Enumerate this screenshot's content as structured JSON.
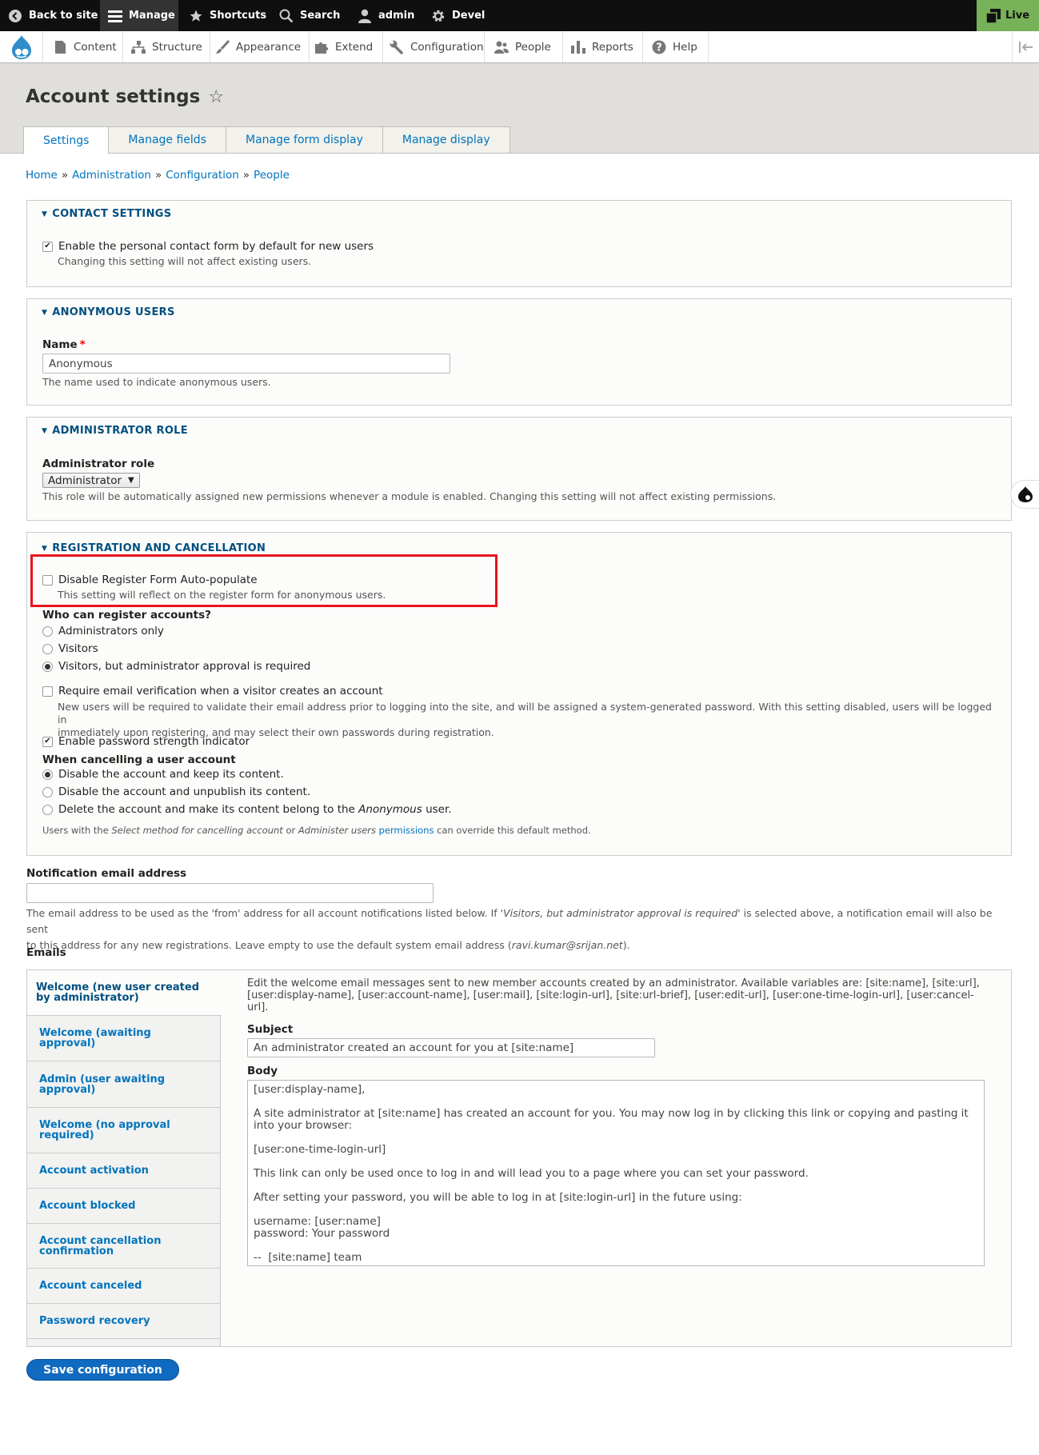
{
  "toolbar": {
    "back_to_site": "Back to site",
    "manage": "Manage",
    "shortcuts": "Shortcuts",
    "search": "Search",
    "user": "admin",
    "devel": "Devel",
    "live": "Live"
  },
  "tray": {
    "items": [
      "Content",
      "Structure",
      "Appearance",
      "Extend",
      "Configuration",
      "People",
      "Reports",
      "Help"
    ]
  },
  "header": {
    "title": "Account settings",
    "tabs": [
      "Settings",
      "Manage fields",
      "Manage form display",
      "Manage display"
    ]
  },
  "breadcrumb": [
    "Home",
    "Administration",
    "Configuration",
    "People"
  ],
  "contact": {
    "legend": "Contact settings",
    "checkbox_label": "Enable the personal contact form by default for new users",
    "checked": true,
    "description": "Changing this setting will not affect existing users."
  },
  "anonymous": {
    "legend": "Anonymous users",
    "name_label": "Name",
    "name_value": "Anonymous",
    "description": "The name used to indicate anonymous users."
  },
  "admin_role": {
    "legend": "Administrator role",
    "label": "Administrator role",
    "selected": "Administrator",
    "description": "This role will be automatically assigned new permissions whenever a module is enabled. Changing this setting will not affect existing permissions."
  },
  "registration": {
    "legend": "Registration and cancellation",
    "disable_autopopulate_label": "Disable Register Form Auto-populate",
    "disable_autopopulate_desc": "This setting will reflect on the register form for anonymous users.",
    "who_label": "Who can register accounts?",
    "who_options": [
      "Administrators only",
      "Visitors",
      "Visitors, but administrator approval is required"
    ],
    "who_selected": 2,
    "email_verify_label": "Require email verification when a visitor creates an account",
    "email_verify_desc_1": "New users will be required to validate their email address prior to logging into the site, and will be assigned a system-generated password. With this setting disabled, users will be logged in",
    "email_verify_desc_2": "immediately upon registering, and may select their own passwords during registration.",
    "pw_strength_label": "Enable password strength indicator",
    "cancel_label": "When cancelling a user account",
    "cancel_options": [
      "Disable the account and keep its content.",
      "Disable the account and unpublish its content."
    ],
    "cancel_opt3_pre": "Delete the account and make its content belong to the",
    "cancel_opt3_em": "Anonymous",
    "cancel_opt3_post": "user.",
    "cancel_desc_pre": "Users with the",
    "cancel_desc_em1": "Select method for cancelling account",
    "cancel_desc_or": "or",
    "cancel_desc_em2": "Administer users",
    "cancel_desc_link": "permissions",
    "cancel_desc_post": "can override this default method."
  },
  "notification": {
    "label": "Notification email address",
    "value": "",
    "desc_1_pre": "The email address to be used as the 'from' address for all account notifications listed below. If '",
    "desc_1_em": "Visitors, but administrator approval is required",
    "desc_1_post": "' is selected above, a notification email will also be sent",
    "desc_2_pre": "to this address for any new registrations. Leave empty to use the default system email address (",
    "desc_2_em": "ravi.kumar@srijan.net",
    "desc_2_post": ")."
  },
  "emails": {
    "label": "Emails",
    "tabs": [
      "Welcome (new user created by administrator)",
      "Welcome (awaiting approval)",
      "Admin (user awaiting approval)",
      "Welcome (no approval required)",
      "Account activation",
      "Account blocked",
      "Account cancellation confirmation",
      "Account canceled",
      "Password recovery"
    ],
    "intro": "Edit the welcome email messages sent to new member accounts created by an administrator. Available variables are: [site:name], [site:url], [user:display-name], [user:account-name], [user:mail], [site:login-url], [site:url-brief], [user:edit-url], [user:one-time-login-url], [user:cancel-url].",
    "subject_label": "Subject",
    "subject_value": "An administrator created an account for you at [site:name]",
    "body_label": "Body",
    "body_value": "[user:display-name],\n\nA site administrator at [site:name] has created an account for you. You may now log in by clicking this link or copying and pasting it into your browser:\n\n[user:one-time-login-url]\n\nThis link can only be used once to log in and will lead you to a page where you can set your password.\n\nAfter setting your password, you will be able to log in at [site:login-url] in the future using:\n\nusername: [user:name]\npassword: Your password\n\n--  [site:name] team"
  },
  "save_button": "Save configuration",
  "colors": {
    "link": "#0074bd",
    "legend": "#004f80",
    "live": "#77b259",
    "highlight": "#e8141d",
    "button": "#0f6ac0"
  }
}
